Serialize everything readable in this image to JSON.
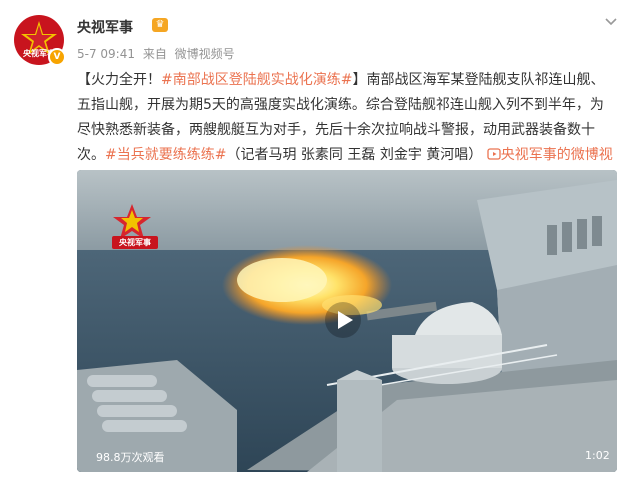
{
  "post": {
    "author": "央视军事",
    "date": "5-7 09:41",
    "source_prefix": "来自",
    "source": "微博视频号",
    "avatar_text": "央视军事",
    "verified_mark": "V"
  },
  "content": {
    "bracket_open": "【火力全开！",
    "hashtag1": "#南部战区登陆舰实战化演练#",
    "text1": "】南部战区海军某登陆舰支队祁连山舰、五指山舰，开展为期5天的高强度实战化演练。综合登陆舰祁连山舰入列不到半年，为尽快熟悉新装备，两艘舰艇互为对手，先后十余次拉响战斗警报，动用武器装备数十次。",
    "hashtag2": "#当兵就要练练练#",
    "text2": "（记者马玥 张素同 王磊 刘金宇 黄河唱）",
    "video_link": "央视军事的微博视频"
  },
  "video": {
    "views": "98.8万次观看",
    "duration": "1:02",
    "watermark_text": "央视军事"
  },
  "colors": {
    "link": "#eb7350",
    "brand_red": "#c8141e"
  }
}
